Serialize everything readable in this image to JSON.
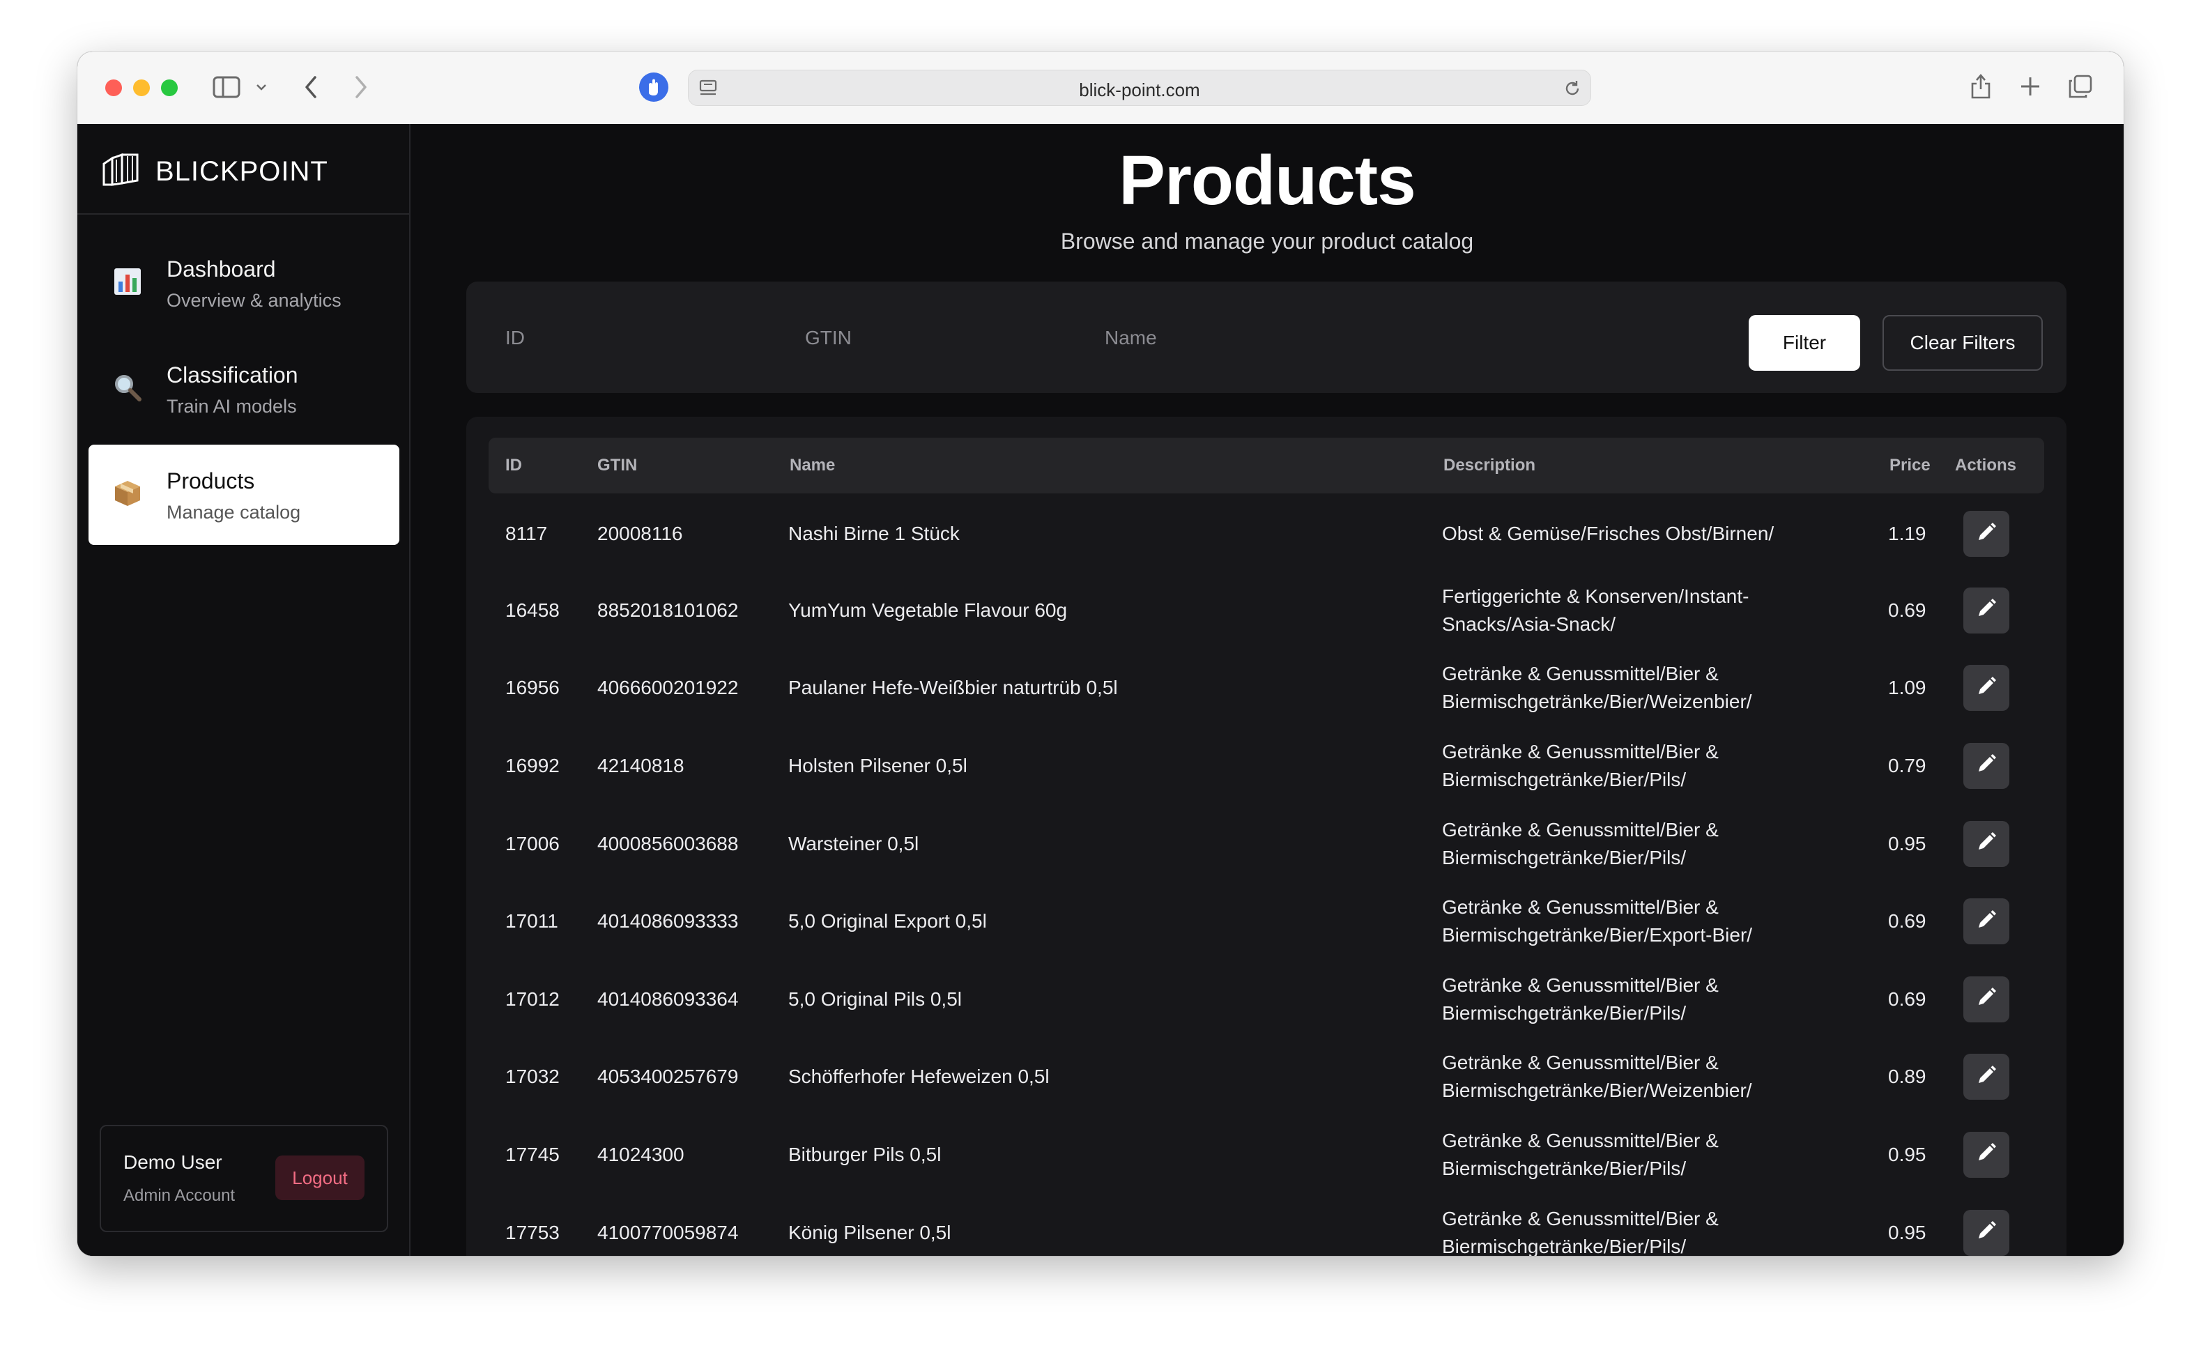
{
  "browser": {
    "url": "blick-point.com"
  },
  "sidebar": {
    "brand": "BLICKPOINT",
    "items": [
      {
        "title": "Dashboard",
        "subtitle": "Overview & analytics",
        "icon": "bar-chart-icon"
      },
      {
        "title": "Classification",
        "subtitle": "Train AI models",
        "icon": "magnifier-icon"
      },
      {
        "title": "Products",
        "subtitle": "Manage catalog",
        "icon": "package-icon"
      }
    ],
    "active_index": 2,
    "user": {
      "name": "Demo User",
      "role": "Admin Account",
      "logout_label": "Logout"
    }
  },
  "main": {
    "title": "Products",
    "subtitle": "Browse and manage your product catalog",
    "filters": {
      "id_placeholder": "ID",
      "gtin_placeholder": "GTIN",
      "name_placeholder": "Name",
      "filter_label": "Filter",
      "clear_label": "Clear Filters"
    },
    "table": {
      "headers": [
        "ID",
        "GTIN",
        "Name",
        "Description",
        "Price",
        "Actions"
      ],
      "rows": [
        {
          "id": "8117",
          "gtin": "20008116",
          "name": "Nashi Birne 1 Stück",
          "description": "Obst & Gemüse/Frisches Obst/Birnen/",
          "price": "1.19"
        },
        {
          "id": "16458",
          "gtin": "8852018101062",
          "name": "YumYum Vegetable Flavour 60g",
          "description": "Fertiggerichte & Konserven/Instant-Snacks/Asia-Snack/",
          "price": "0.69"
        },
        {
          "id": "16956",
          "gtin": "4066600201922",
          "name": "Paulaner Hefe-Weißbier naturtrüb 0,5l",
          "description": "Getränke & Genussmittel/Bier & Biermischgetränke/Bier/Weizenbier/",
          "price": "1.09"
        },
        {
          "id": "16992",
          "gtin": "42140818",
          "name": "Holsten Pilsener 0,5l",
          "description": "Getränke & Genussmittel/Bier & Biermischgetränke/Bier/Pils/",
          "price": "0.79"
        },
        {
          "id": "17006",
          "gtin": "4000856003688",
          "name": "Warsteiner 0,5l",
          "description": "Getränke & Genussmittel/Bier & Biermischgetränke/Bier/Pils/",
          "price": "0.95"
        },
        {
          "id": "17011",
          "gtin": "4014086093333",
          "name": "5,0 Original Export 0,5l",
          "description": "Getränke & Genussmittel/Bier & Biermischgetränke/Bier/Export-Bier/",
          "price": "0.69"
        },
        {
          "id": "17012",
          "gtin": "4014086093364",
          "name": "5,0 Original Pils 0,5l",
          "description": "Getränke & Genussmittel/Bier & Biermischgetränke/Bier/Pils/",
          "price": "0.69"
        },
        {
          "id": "17032",
          "gtin": "4053400257679",
          "name": "Schöfferhofer Hefeweizen 0,5l",
          "description": "Getränke & Genussmittel/Bier & Biermischgetränke/Bier/Weizenbier/",
          "price": "0.89"
        },
        {
          "id": "17745",
          "gtin": "41024300",
          "name": "Bitburger Pils 0,5l",
          "description": "Getränke & Genussmittel/Bier & Biermischgetränke/Bier/Pils/",
          "price": "0.95"
        },
        {
          "id": "17753",
          "gtin": "4100770059874",
          "name": "König Pilsener 0,5l",
          "description": "Getränke & Genussmittel/Bier & Biermischgetränke/Bier/Pils/",
          "price": "0.95"
        }
      ],
      "row_action_icon": "pencil-icon"
    }
  },
  "colors": {
    "background": "#0d0d0f",
    "surface": "#1c1c1f",
    "logout_text": "#f26d84",
    "active_nav": "#ffffff"
  }
}
